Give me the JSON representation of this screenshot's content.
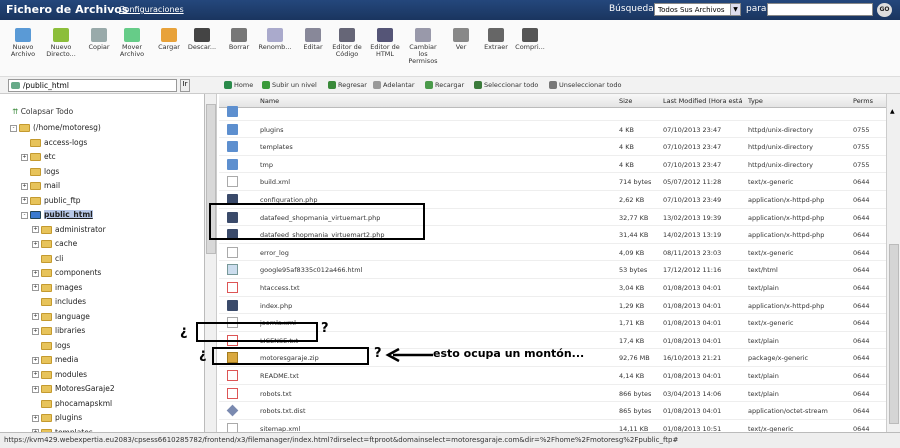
{
  "header": {
    "app_title": "Fichero de Archivos",
    "config_link": "Configuraciones",
    "search_label": "Búsqueda",
    "search_scope": "Todos Sus Archivos",
    "for_label": "para",
    "search_value": "",
    "go_label": "GO"
  },
  "toolbar": [
    {
      "label": "Nuevo Archivo",
      "icon": "new-file-icon",
      "color": "#5a9ad6"
    },
    {
      "label": "Nuevo Directo...",
      "icon": "new-folder-icon",
      "color": "#8cbe3a"
    },
    {
      "label": "Copiar",
      "icon": "copy-icon",
      "color": "#9aa"
    },
    {
      "label": "Mover Archivo",
      "icon": "move-icon",
      "color": "#6c8"
    },
    {
      "label": "Cargar",
      "icon": "upload-icon",
      "color": "#e8a23a"
    },
    {
      "label": "Descar...",
      "icon": "download-icon",
      "color": "#444"
    },
    {
      "label": "Borrar",
      "icon": "delete-icon",
      "color": "#777"
    },
    {
      "label": "Renomb...",
      "icon": "rename-icon",
      "color": "#aac"
    },
    {
      "label": "Editar",
      "icon": "edit-icon",
      "color": "#889"
    },
    {
      "label": "Editor de Código",
      "icon": "code-editor-icon",
      "color": "#667"
    },
    {
      "label": "Editor de HTML",
      "icon": "html-editor-icon",
      "color": "#557"
    },
    {
      "label": "Cambiar los Permisos",
      "icon": "permissions-icon",
      "color": "#99a"
    },
    {
      "label": "Ver",
      "icon": "view-icon",
      "color": "#888"
    },
    {
      "label": "Extraer",
      "icon": "extract-icon",
      "color": "#666"
    },
    {
      "label": "Compri...",
      "icon": "compress-icon",
      "color": "#555"
    }
  ],
  "path": "/public_html",
  "path_go": "Ir",
  "nav": [
    {
      "label": "Home",
      "icon": "home-icon",
      "color": "#2a8a4a"
    },
    {
      "label": "Subir un nivel",
      "icon": "up-level-icon",
      "color": "#3a9a3a"
    },
    {
      "label": "Regresar",
      "icon": "back-icon",
      "color": "#3a8a3a"
    },
    {
      "label": "Adelantar",
      "icon": "forward-icon",
      "color": "#999"
    },
    {
      "label": "Recargar",
      "icon": "reload-icon",
      "color": "#4a9a4a"
    },
    {
      "label": "Seleccionar todo",
      "icon": "select-all-icon",
      "color": "#3a7a3a"
    },
    {
      "label": "Unseleccionar todo",
      "icon": "unselect-all-icon",
      "color": "#777"
    }
  ],
  "tree": {
    "collapse_label": "Colapsar Todo",
    "nodes": [
      {
        "label": "(/home/motoresg)",
        "indent": 0,
        "toggle": "-"
      },
      {
        "label": "access-logs",
        "indent": 1,
        "toggle": ""
      },
      {
        "label": "etc",
        "indent": 1,
        "toggle": "+"
      },
      {
        "label": "logs",
        "indent": 1,
        "toggle": ""
      },
      {
        "label": "mail",
        "indent": 1,
        "toggle": "+"
      },
      {
        "label": "public_ftp",
        "indent": 1,
        "toggle": "+"
      },
      {
        "label": "public_html",
        "indent": 1,
        "toggle": "-",
        "selected": true
      },
      {
        "label": "administrator",
        "indent": 2,
        "toggle": "+"
      },
      {
        "label": "cache",
        "indent": 2,
        "toggle": "+"
      },
      {
        "label": "cli",
        "indent": 2,
        "toggle": ""
      },
      {
        "label": "components",
        "indent": 2,
        "toggle": "+"
      },
      {
        "label": "images",
        "indent": 2,
        "toggle": "+"
      },
      {
        "label": "includes",
        "indent": 2,
        "toggle": ""
      },
      {
        "label": "language",
        "indent": 2,
        "toggle": "+"
      },
      {
        "label": "libraries",
        "indent": 2,
        "toggle": "+"
      },
      {
        "label": "logs",
        "indent": 2,
        "toggle": ""
      },
      {
        "label": "media",
        "indent": 2,
        "toggle": "+"
      },
      {
        "label": "modules",
        "indent": 2,
        "toggle": "+"
      },
      {
        "label": "MotoresGaraje2",
        "indent": 2,
        "toggle": "+"
      },
      {
        "label": "phocamapskml",
        "indent": 2,
        "toggle": ""
      },
      {
        "label": "plugins",
        "indent": 2,
        "toggle": "+"
      },
      {
        "label": "templates",
        "indent": 2,
        "toggle": "+"
      }
    ]
  },
  "columns": [
    "Name",
    "Size",
    "Last Modified (Hora está",
    "Type",
    "Perms"
  ],
  "files": [
    {
      "name": "",
      "size": "",
      "modified": "",
      "type": "",
      "perms": "",
      "icon": "folder"
    },
    {
      "name": "plugins",
      "size": "4 KB",
      "modified": "07/10/2013 23:47",
      "type": "httpd/unix-directory",
      "perms": "0755",
      "icon": "folder"
    },
    {
      "name": "templates",
      "size": "4 KB",
      "modified": "07/10/2013 23:47",
      "type": "httpd/unix-directory",
      "perms": "0755",
      "icon": "folder"
    },
    {
      "name": "tmp",
      "size": "4 KB",
      "modified": "07/10/2013 23:47",
      "type": "httpd/unix-directory",
      "perms": "0755",
      "icon": "folder"
    },
    {
      "name": "build.xml",
      "size": "714 bytes",
      "modified": "05/07/2012 11:28",
      "type": "text/x-generic",
      "perms": "0644",
      "icon": "txt"
    },
    {
      "name": "configuration.php",
      "size": "2,62 KB",
      "modified": "07/10/2013 23:49",
      "type": "application/x-httpd-php",
      "perms": "0644",
      "icon": "php"
    },
    {
      "name": "datafeed_shopmania_virtuemart.php",
      "size": "32,77 KB",
      "modified": "13/02/2013 19:39",
      "type": "application/x-httpd-php",
      "perms": "0644",
      "icon": "php"
    },
    {
      "name": "datafeed_shopmania_virtuemart2.php",
      "size": "31,44 KB",
      "modified": "14/02/2013 13:19",
      "type": "application/x-httpd-php",
      "perms": "0644",
      "icon": "php"
    },
    {
      "name": "error_log",
      "size": "4,09 KB",
      "modified": "08/11/2013 23:03",
      "type": "text/x-generic",
      "perms": "0644",
      "icon": "txt"
    },
    {
      "name": "google95af8335c012a466.html",
      "size": "53 bytes",
      "modified": "17/12/2012 11:16",
      "type": "text/html",
      "perms": "0644",
      "icon": "html"
    },
    {
      "name": "htaccess.txt",
      "size": "3,04 KB",
      "modified": "01/08/2013 04:01",
      "type": "text/plain",
      "perms": "0644",
      "icon": "ht"
    },
    {
      "name": "index.php",
      "size": "1,29 KB",
      "modified": "01/08/2013 04:01",
      "type": "application/x-httpd-php",
      "perms": "0644",
      "icon": "php"
    },
    {
      "name": "joomla.xml",
      "size": "1,71 KB",
      "modified": "01/08/2013 04:01",
      "type": "text/x-generic",
      "perms": "0644",
      "icon": "txt"
    },
    {
      "name": "LICENSE.txt",
      "size": "17,4 KB",
      "modified": "01/08/2013 04:01",
      "type": "text/plain",
      "perms": "0644",
      "icon": "ht"
    },
    {
      "name": "motoresgaraje.zip",
      "size": "92,76 MB",
      "modified": "16/10/2013 21:21",
      "type": "package/x-generic",
      "perms": "0644",
      "icon": "zip"
    },
    {
      "name": "README.txt",
      "size": "4,14 KB",
      "modified": "01/08/2013 04:01",
      "type": "text/plain",
      "perms": "0644",
      "icon": "ht"
    },
    {
      "name": "robots.txt",
      "size": "866 bytes",
      "modified": "03/04/2013 14:06",
      "type": "text/plain",
      "perms": "0644",
      "icon": "ht"
    },
    {
      "name": "robots.txt.dist",
      "size": "865 bytes",
      "modified": "01/08/2013 04:01",
      "type": "application/octet-stream",
      "perms": "0644",
      "icon": "bin"
    },
    {
      "name": "sitemap.xml",
      "size": "14,11 KB",
      "modified": "01/08/2013 10:51",
      "type": "text/x-generic",
      "perms": "0644",
      "icon": "txt"
    }
  ],
  "status_url": "https://kvm429.webexpertia.eu2083/cpsess6610285782/frontend/x3/filemanager/index.html?dirselect=ftproot&domainselect=motoresgaraje.com&dir=%2Fhome%2Fmotoresg%2Fpublic_ftp#",
  "annotations": {
    "q1": "¿",
    "q2": "?",
    "q3": "¿",
    "q4": "?",
    "note": "esto ocupa un montón..."
  }
}
